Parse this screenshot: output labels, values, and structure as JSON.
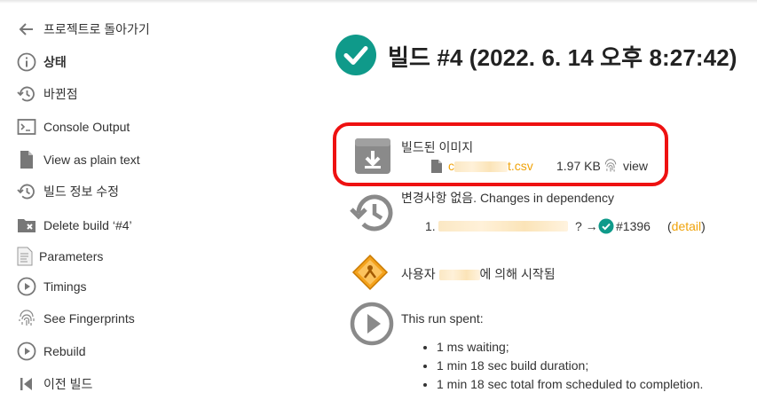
{
  "sidebar": {
    "items": [
      {
        "label": "프로젝트로 돌아가기",
        "icon": "arrow-left-icon"
      },
      {
        "label": "상태",
        "icon": "info-icon"
      },
      {
        "label": "바뀐점",
        "icon": "history-icon"
      },
      {
        "label": "Console Output",
        "icon": "terminal-icon"
      },
      {
        "label": "View as plain text",
        "icon": "document-icon"
      },
      {
        "label": "빌드 정보 수정",
        "icon": "history-icon"
      },
      {
        "label": "Delete build ‘#4’",
        "icon": "folder-delete-icon"
      },
      {
        "label": "Parameters",
        "icon": "parameters-icon"
      },
      {
        "label": "Timings",
        "icon": "play-circle-icon"
      },
      {
        "label": "See Fingerprints",
        "icon": "fingerprint-icon"
      },
      {
        "label": "Rebuild",
        "icon": "play-circle-icon"
      },
      {
        "label": "이전 빌드",
        "icon": "skip-previous-icon"
      }
    ]
  },
  "build": {
    "title": "빌드 #4 (2022. 6. 14 오후 8:27:42)",
    "status_color": "#0f9a8a"
  },
  "artifacts": {
    "heading": "빌드된 이미지",
    "file_prefix": "c",
    "file_suffix": "t.csv",
    "size": "1.97 KB",
    "view_label": "view"
  },
  "changes": {
    "text": "변경사항 없음. Changes in dependency",
    "index": "1.",
    "arrow_text": "? →",
    "build_link": "#1396",
    "detail_label": "detail",
    "paren_open": "(",
    "paren_close": ")"
  },
  "started_by": {
    "prefix": "사용자 ",
    "suffix": "에 의해 시작됨"
  },
  "run": {
    "heading": "This run spent:",
    "items": [
      "1 ms waiting;",
      "1 min 18 sec build duration;",
      "1 min 18 sec total from scheduled to completion."
    ]
  },
  "colors": {
    "accent": "#f0a30a",
    "highlight": "#ee1111",
    "icon_gray": "#777777"
  }
}
